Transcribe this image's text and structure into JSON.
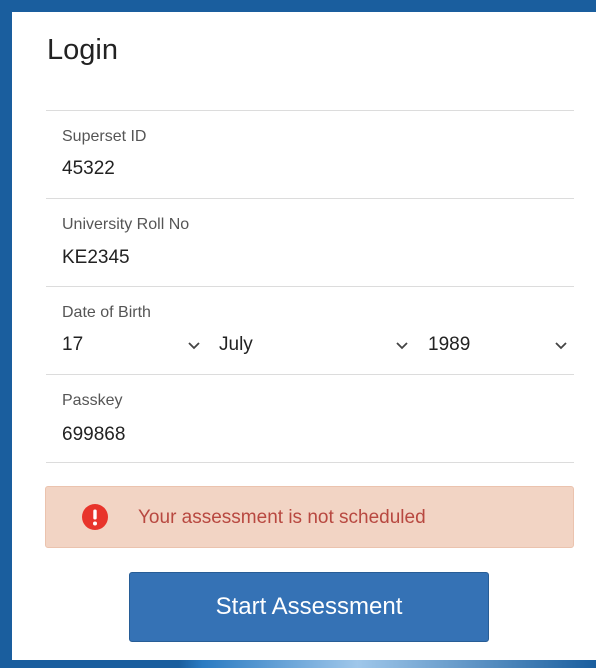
{
  "title": "Login",
  "fields": {
    "superset_id": {
      "label": "Superset ID",
      "value": "45322"
    },
    "roll_no": {
      "label": "University Roll No",
      "value": "KE2345"
    },
    "dob": {
      "label": "Date of Birth",
      "day": "17",
      "month": "July",
      "year": "1989"
    },
    "passkey": {
      "label": "Passkey",
      "value": "699868"
    }
  },
  "alert": {
    "text": "Your assessment is not scheduled",
    "icon": "exclamation-circle-icon",
    "color": "#e8342b"
  },
  "button": {
    "label": "Start Assessment",
    "color": "#3572b5"
  },
  "colors": {
    "frame": "#1a5e9e",
    "alert_bg": "#f2d4c4",
    "alert_text": "#b84840"
  }
}
